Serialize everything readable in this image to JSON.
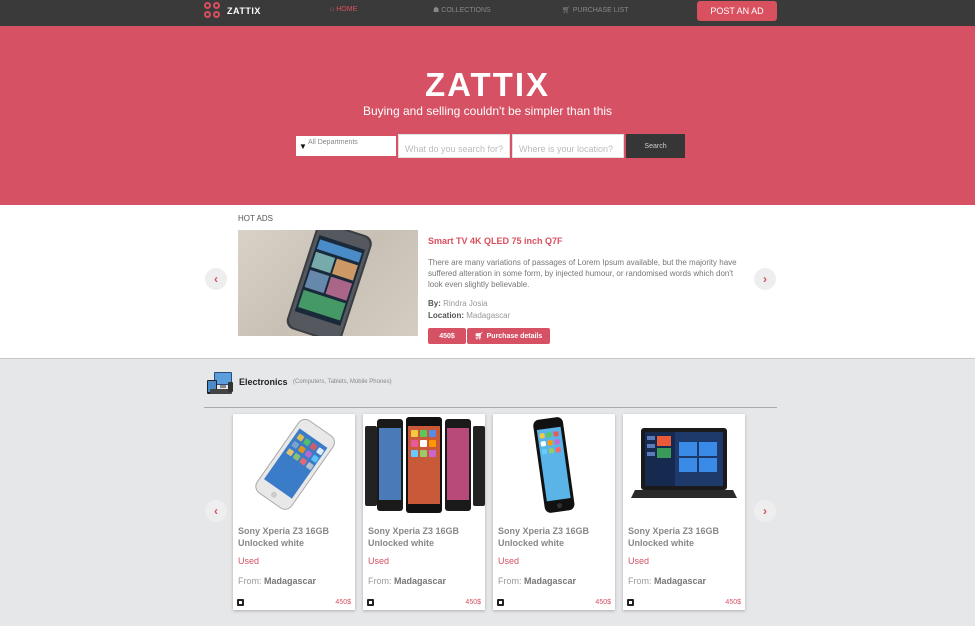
{
  "nav": {
    "logo_text": "ZATTIX",
    "links": [
      {
        "label": "HOME",
        "icon": "home-icon"
      },
      {
        "label": "COLLECTIONS",
        "icon": "users-icon"
      },
      {
        "label": "PURCHASE LIST",
        "icon": "cart-icon"
      }
    ],
    "post_button": "POST AN AD"
  },
  "hero": {
    "title": "ZATTIX",
    "subtitle": "Buying and selling couldn't be simpler than this",
    "department_select": "All Departments",
    "search_placeholder": "What do you search for?",
    "location_placeholder": "Where is your location?",
    "search_button": "Search"
  },
  "hot_ads": {
    "label": "HOT ADS",
    "title": "Smart TV 4K QLED 75 inch Q7F",
    "description": "There are many variations of passages of Lorem Ipsum available, but the majority have suffered alteration in some form, by injected humour, or randomised words which don't look even slightly believable.",
    "by_label": "By:",
    "by_value": "Rindra Josia",
    "location_label": "Location:",
    "location_value": "Madagascar",
    "price": "450$",
    "details_button": "Purchase details"
  },
  "electronics": {
    "title": "Electronics",
    "subtitle": "(Computers, Tablets, Mobile Phones)",
    "products": [
      {
        "name": "Sony Xperia Z3 16GB Unlocked white",
        "condition": "Used",
        "from_label": "From:",
        "from_value": "Madagascar",
        "price": "450$",
        "image": "iphone-tilted"
      },
      {
        "name": "Sony Xperia Z3 16GB Unlocked white",
        "condition": "Used",
        "from_label": "From:",
        "from_value": "Madagascar",
        "price": "450$",
        "image": "android-phones"
      },
      {
        "name": "Sony Xperia Z3 16GB Unlocked white",
        "condition": "Used",
        "from_label": "From:",
        "from_value": "Madagascar",
        "price": "450$",
        "image": "iphone-upright"
      },
      {
        "name": "Sony Xperia Z3 16GB Unlocked white",
        "condition": "Used",
        "from_label": "From:",
        "from_value": "Madagascar",
        "price": "450$",
        "image": "laptop-windows"
      }
    ]
  },
  "colors": {
    "accent": "#d65163",
    "nav_bg": "#3a3a3a",
    "section_bg": "#e6e7e9"
  }
}
